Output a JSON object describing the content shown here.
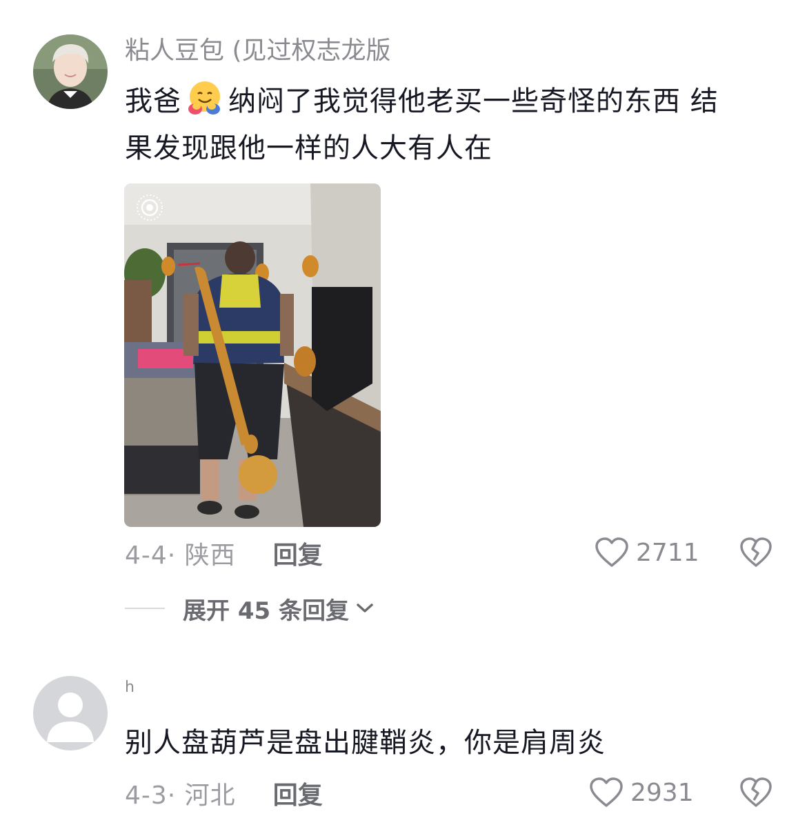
{
  "comments": [
    {
      "username": "粘人豆包 (见过权志龙版",
      "text_line1_before": "我爸",
      "text_line1_after": "纳闷了我觉得他老买一些奇怪的东西 结",
      "text_line2": "果发现跟他一样的人大有人在",
      "emoji": "hugging-face-emoji",
      "date": "4-4· 陕西",
      "reply_label": "回复",
      "likes": "2711",
      "expand_label": "展开 45 条回复"
    },
    {
      "username": "h",
      "text": "别人盘葫芦是盘出腱鞘炎，你是肩周炎",
      "date": "4-3· 河北",
      "reply_label": "回复",
      "likes": "2931"
    }
  ],
  "icons": {
    "like": "heart-outline-icon",
    "dislike": "broken-heart-icon",
    "expand": "chevron-down-icon",
    "live_photo": "live-photo-icon"
  },
  "colors": {
    "text": "#161823",
    "muted": "#8a8b91",
    "background": "#ffffff"
  }
}
